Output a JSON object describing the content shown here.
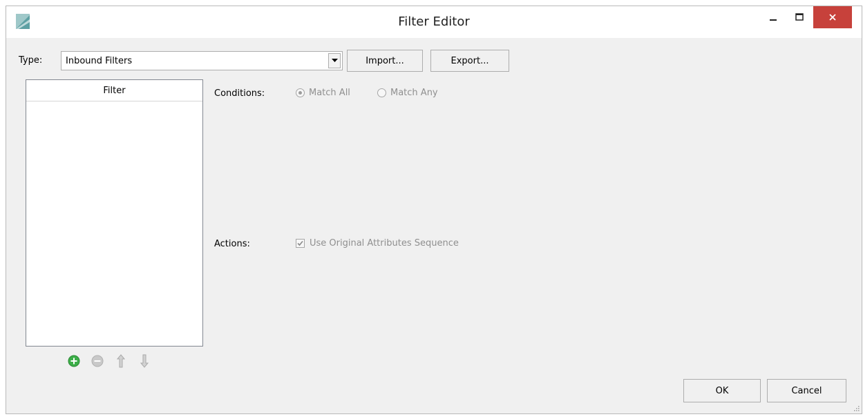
{
  "window": {
    "title": "Filter Editor",
    "controls": {
      "minimize_icon": "minimize-icon",
      "maximize_icon": "maximize-icon",
      "close_icon": "close-icon"
    }
  },
  "type_row": {
    "label": "Type:",
    "selected": "Inbound Filters",
    "import_label": "Import...",
    "export_label": "Export..."
  },
  "filter_list": {
    "header": "Filter",
    "items": [],
    "tools": [
      "add-icon",
      "remove-icon",
      "move-up-icon",
      "move-down-icon"
    ]
  },
  "conditions": {
    "label": "Conditions:",
    "options": [
      {
        "label": "Match All",
        "selected": true
      },
      {
        "label": "Match Any",
        "selected": false
      }
    ]
  },
  "actions": {
    "label": "Actions:",
    "checkbox_label": "Use Original Attributes Sequence",
    "checked": true
  },
  "footer": {
    "ok_label": "OK",
    "cancel_label": "Cancel"
  },
  "colors": {
    "close_button": "#c7413b",
    "add_icon": "#3cae48",
    "disabled_text": "#8f8f8f"
  }
}
